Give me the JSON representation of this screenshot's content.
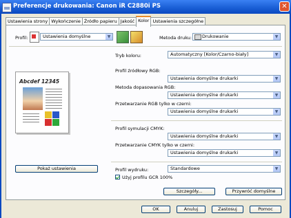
{
  "window": {
    "title": "Preferencje drukowania: Canon iR C2880i PS"
  },
  "tabs": [
    {
      "label": "Ustawienia strony"
    },
    {
      "label": "Wykończenie"
    },
    {
      "label": "Źródło papieru"
    },
    {
      "label": "Jakość"
    },
    {
      "label": "Kolor"
    },
    {
      "label": "Ustawienia szczegółne"
    }
  ],
  "active_tab": "Kolor",
  "profile": {
    "label": "Profil:",
    "value": "Ustawienia domyślne"
  },
  "print_method": {
    "label": "Metoda druku:",
    "value": "Drukowanie"
  },
  "preview": {
    "sample_text": "Abcdef 12345"
  },
  "color_mode": {
    "label": "Tryb koloru:",
    "value": "Automatyczny [Kolor/Czarno-biały]"
  },
  "rgb_source_profile": {
    "label": "Profil źródłowy RGB:",
    "value": "Ustawienia domyślne drukarki"
  },
  "matching_method": {
    "label": "Metoda dopasowania RGB:",
    "value": "Ustawienia domyślne drukarki"
  },
  "rgb_black_processing": {
    "label": "Przetwarzanie RGB tylko w czerni:",
    "value": "Ustawienia domyślne drukarki"
  },
  "cmyk_simulation_profile": {
    "label": "Profil symulacji CMYK:",
    "value": "Ustawienia domyślne drukarki"
  },
  "cmyk_black_processing": {
    "label": "Przetwarzanie CMYK tylko w czerni:",
    "value": "Ustawienia domyślne drukarki"
  },
  "output_profile": {
    "label": "Profil wydruku:",
    "value": "Standardowe"
  },
  "gcr_checkbox": {
    "label": "Użyj profilu GCR 100%",
    "checked": true
  },
  "buttons": {
    "show_settings": "Pokaż ustawienia",
    "details": "Szczegóły...",
    "restore_defaults": "Przywróć domyślne",
    "ok": "OK",
    "cancel": "Anuluj",
    "apply": "Zastosuj",
    "help": "Pomoc"
  }
}
